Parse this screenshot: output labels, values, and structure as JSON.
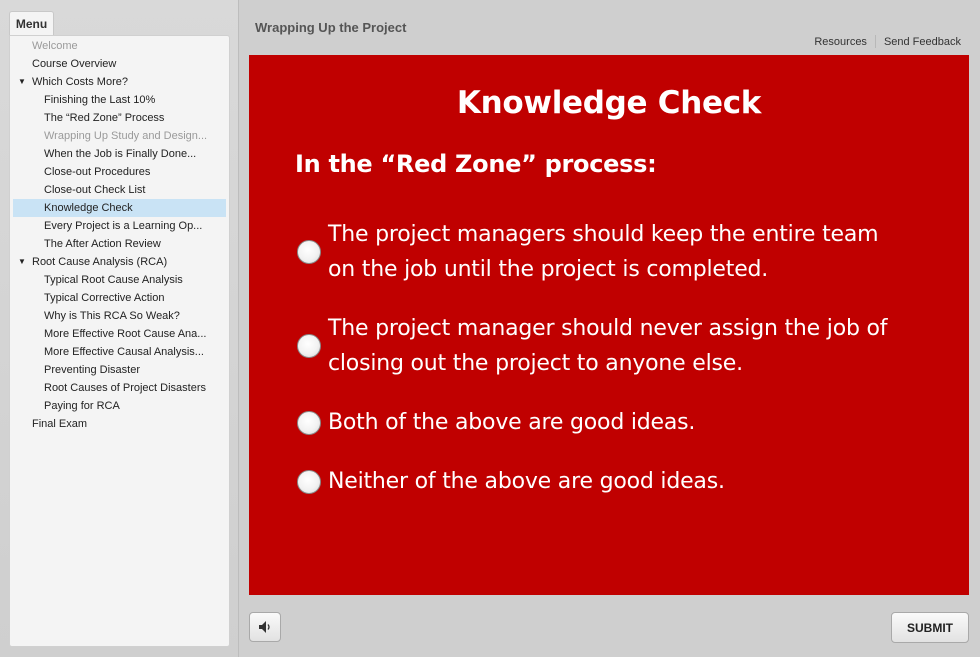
{
  "sidebar": {
    "tab_label": "Menu",
    "items": [
      {
        "label": "Welcome",
        "level": 0,
        "visited": true
      },
      {
        "label": "Course Overview",
        "level": 0
      },
      {
        "label": "Which Costs More?",
        "level": 0,
        "expanded": true
      },
      {
        "label": "Finishing the Last 10%",
        "level": 1
      },
      {
        "label": "The “Red Zone” Process",
        "level": 1
      },
      {
        "label": "Wrapping Up Study and Design...",
        "level": 1,
        "visited": true
      },
      {
        "label": "When the Job is Finally Done...",
        "level": 1
      },
      {
        "label": "Close-out Procedures",
        "level": 1
      },
      {
        "label": "Close-out Check List",
        "level": 1
      },
      {
        "label": "Knowledge Check",
        "level": 1,
        "selected": true
      },
      {
        "label": "Every Project is a Learning Op...",
        "level": 1
      },
      {
        "label": "The After Action Review",
        "level": 1
      },
      {
        "label": "Root Cause Analysis (RCA)",
        "level": 0,
        "expanded": true
      },
      {
        "label": "Typical Root Cause Analysis",
        "level": 1
      },
      {
        "label": "Typical Corrective Action",
        "level": 1
      },
      {
        "label": "Why is This RCA So Weak?",
        "level": 1
      },
      {
        "label": "More Effective Root Cause Ana...",
        "level": 1
      },
      {
        "label": "More Effective Causal Analysis...",
        "level": 1
      },
      {
        "label": "Preventing Disaster",
        "level": 1
      },
      {
        "label": "Root Causes of Project Disasters",
        "level": 1
      },
      {
        "label": "Paying for RCA",
        "level": 1
      },
      {
        "label": "Final Exam",
        "level": 0
      }
    ]
  },
  "header": {
    "title": "Wrapping Up the Project",
    "links": [
      "Resources",
      "Send Feedback"
    ]
  },
  "slide": {
    "background": "#c00000",
    "title": "Knowledge Check",
    "question": "In the “Red Zone” process:",
    "options": [
      {
        "lines": [
          "The project managers should keep the entire team",
          "on the job until the project is completed."
        ]
      },
      {
        "lines": [
          "The project manager should never assign the job of",
          "closing out the project to anyone else."
        ]
      },
      {
        "lines": [
          "Both of the above are good ideas."
        ]
      },
      {
        "lines": [
          "Neither of the above are good ideas."
        ]
      }
    ]
  },
  "footer": {
    "audio_icon": "speaker-icon",
    "submit_label": "SUBMIT"
  }
}
